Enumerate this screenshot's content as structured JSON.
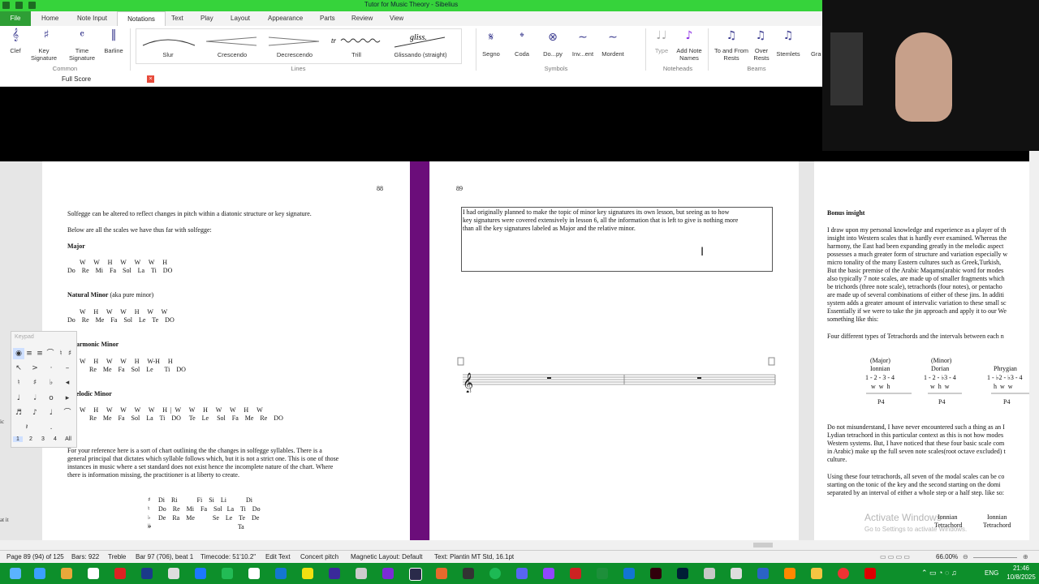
{
  "window": {
    "title": "Tutor for Music Theory - Sibelius"
  },
  "ribbon_tabs": [
    "File",
    "Home",
    "Note Input",
    "Notations",
    "Text",
    "Play",
    "Layout",
    "Appearance",
    "Parts",
    "Review",
    "View"
  ],
  "ribbon": {
    "common": {
      "label": "Common",
      "items": [
        "Clef",
        "Key Signature",
        "Time Signature",
        "Barline"
      ]
    },
    "lines": {
      "label": "Lines",
      "items": [
        "Slur",
        "Crescendo",
        "Decrescendo",
        "Trill",
        "Glissando (straight)"
      ],
      "gliss_text": "gliss.",
      "trill_text": "tr"
    },
    "symbols": {
      "label": "Symbols",
      "items": [
        "Segno",
        "Coda",
        "Do...py",
        "Inv...ent",
        "Mordent"
      ]
    },
    "noteheads": {
      "label": "Noteheads",
      "items": [
        "Type",
        "Add Note Names"
      ]
    },
    "beams": {
      "label": "Beams",
      "items": [
        "To and From Rests",
        "Over Rests",
        "Stemlets"
      ]
    },
    "cut_off": "Gra"
  },
  "score_tab": {
    "label": "Full Score"
  },
  "page88": {
    "number": "88",
    "intro1": "Solfegge can be altered to reflect changes in pitch within a diatonic structure or key signature.",
    "intro2": "Below are all the scales we have thus far with solfegge:",
    "major": {
      "title": "Major",
      "steps": "W     W     H     W     W     W     H",
      "syll": "Do    Re    Mi    Fa    Sol    La    Ti    DO"
    },
    "natural": {
      "title": "Natural Minor",
      "sub": "(aka pure minor)",
      "steps": "W     H     W     W     H     W     W",
      "syll": "Do    Re    Me    Fa    Sol    Le    Te    DO"
    },
    "harmonic": {
      "title": "armonic Minor",
      "steps": "W     H     W     W     H     W-H     H",
      "syll": "Re    Me    Fa    Sol    Le       Ti    DO"
    },
    "melodic": {
      "title": "elodic Minor",
      "steps": "W     H     W     W     W     W     H  |  W     W     H     W     W     H     W",
      "syll": "Re    Me    Fa    Sol    La    Ti    DO     Te    Le     Sol    Fa    Me    Re    DO"
    },
    "para": [
      "For your reference here is a sort of chart outlining the the changes in solfegge syllables. There is a",
      "general principal that dictates which syllable follows which, but it is not a strict one. This is one of those",
      "instances in music where a set standard does not exist hence the incomplete nature of the chart. Where",
      "there is information missing, the practitioner is at liberty to create."
    ],
    "chart": {
      "acc": [
        "♯",
        "♮",
        "♭",
        "𝄫"
      ],
      "rows": [
        "Di    Ri            Fi    Si    Li            Di",
        "Do    Re    Mi    Fa    Sol   La    Ti    Do",
        "De    Ra    Me           Se    Le    Te    De",
        "                                                 Ta"
      ]
    }
  },
  "page89": {
    "number": "89",
    "box": [
      "I had originally planned to make the topic of minor key signatures its own lesson, but seeing as to how",
      "key signatures were covered extensively in lesson 6, all the information that is left to give is nothing more",
      "than all the key signatures labeled as Major and the relative minor."
    ]
  },
  "page90": {
    "heading": "Bonus insight",
    "p1": [
      "I draw upon my personal knowledge and experience as a player of th",
      "insight into Western scales that is hardly ever examined. Whereas the",
      "harmony, the East had been expanding greatly in the melodic aspect",
      "possesses a much greater form of structure and variation especially w",
      "micro tonality of the many Eastern cultures such as Greek,Turkish,",
      "But the basic premise of the Arabic Maqams(arabic word for modes",
      "also typically 7 note scales, are made up of smaller fragments which",
      "be trichords (three note scale), tetrachords (four notes), or pentacho",
      "are made up of several combinations of either of these jins. In additi",
      "system adds a greater amount of intervalic variation to these small sc",
      "Essentially if we were to take the jin approach and apply it to our We",
      "something like this:"
    ],
    "p2": "Four different types of Tetrachords and the intervals between each n",
    "tetra": [
      {
        "top": "(Major)",
        "name": "Ionnian",
        "nums": "1 - 2 - 3 - 4",
        "ints": "w  w  h",
        "p": "P4"
      },
      {
        "top": "(Minor)",
        "name": "Dorian",
        "nums": "1 - 2 - ♭3 - 4",
        "ints": "w  h  w",
        "p": "P4"
      },
      {
        "top": "",
        "name": "Phrygian",
        "nums": "1 - ♭2 - ♭3 - 4",
        "ints": "h  w  w",
        "p": "P4"
      }
    ],
    "p3": [
      "Do not misunderstand, I have never encountered such a thing as an I",
      "Lydian tetrachord in this particular context as this is not how modes",
      "Western systems. But, I have noticed that these four basic scale com",
      "in Arabic) make up the full seven note scales(root octave excluded) t",
      "culture."
    ],
    "p4": [
      "Using these four tetrachords, all seven of the modal scales can be co",
      "starting on the tonic of the key and the second starting on the domi",
      "separated by an interval of either a whole step or a half step. like so:"
    ],
    "bottom": [
      {
        "l1": "Ionnian",
        "l2": "Tetrachord"
      },
      {
        "l1": "Ionnian",
        "l2": "Tetrachord"
      }
    ]
  },
  "keypad": {
    "title": "Keypad",
    "layouts": [
      "1",
      "2",
      "3",
      "4",
      "All"
    ]
  },
  "watermark": {
    "line1": "Activate Windows",
    "line2": "Go to Settings to activate Windows."
  },
  "side_text": [
    "ic",
    "at it"
  ],
  "status": {
    "page": "Page 89 (94) of 125",
    "bars": "Bars: 922",
    "clef": "Treble",
    "bar": "Bar 97 (706), beat 1",
    "timecode": "Timecode: 51'10.2\"",
    "mode": "Edit Text",
    "pitch": "Concert pitch",
    "layout": "Magnetic Layout: Default",
    "text": "Text: Plantin MT Std, 16.1pt",
    "zoom": "66.00%"
  },
  "taskbar": {
    "lang": "ENG",
    "time": "21:46",
    "date": "10/8/2025"
  }
}
